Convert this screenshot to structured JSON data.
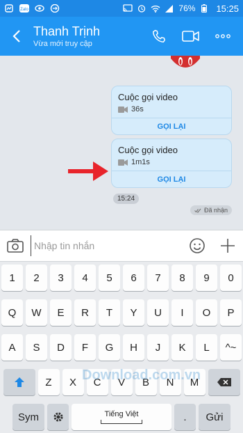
{
  "status": {
    "battery": "76%",
    "time": "15:25"
  },
  "header": {
    "contact_name": "Thanh Trịnh",
    "status": "Vừa mới truy cập"
  },
  "chat": {
    "messages": [
      {
        "title": "Cuộc gọi video",
        "duration": "36s",
        "action": "GỌI LẠI"
      },
      {
        "title": "Cuộc gọi video",
        "duration": "1m1s",
        "action": "GỌI LẠI"
      }
    ],
    "time_chip": "15:24",
    "received": "Đã nhận"
  },
  "input": {
    "placeholder": "Nhập tin nhắn"
  },
  "keyboard": {
    "row_numbers": [
      "1",
      "2",
      "3",
      "4",
      "5",
      "6",
      "7",
      "8",
      "9",
      "0"
    ],
    "row_q": [
      "Q",
      "W",
      "E",
      "R",
      "T",
      "Y",
      "U",
      "I",
      "O",
      "P"
    ],
    "row_a": [
      "A",
      "S",
      "D",
      "F",
      "G",
      "H",
      "J",
      "K",
      "L",
      "^~"
    ],
    "row_z": [
      "Z",
      "X",
      "C",
      "V",
      "B",
      "N",
      "M"
    ],
    "sym": "Sym",
    "space": "Tiếng Việt",
    "dot": ".",
    "send": "Gửi"
  },
  "watermark": "Download.com.vn",
  "colors": {
    "accent": "#2196f3",
    "bubble": "#d6ecfb",
    "arrow": "#e8242b"
  }
}
